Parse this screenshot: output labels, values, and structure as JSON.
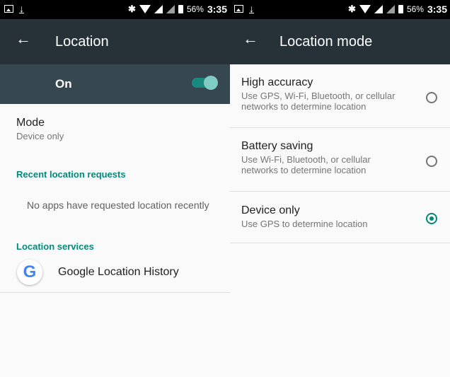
{
  "left": {
    "status": {
      "battery": "56%",
      "time": "3:35"
    },
    "title": "Location",
    "master_switch": {
      "label": "On",
      "state": "on"
    },
    "mode": {
      "title": "Mode",
      "value": "Device only"
    },
    "recent_header": "Recent location requests",
    "recent_empty": "No apps have requested location recently",
    "services_header": "Location services",
    "services": [
      {
        "icon": "google-g-icon",
        "letter": "G",
        "label": "Google Location History"
      }
    ]
  },
  "right": {
    "status": {
      "battery": "56%",
      "time": "3:35"
    },
    "title": "Location mode",
    "options": [
      {
        "title": "High accuracy",
        "desc_line1": "Use GPS, Wi-Fi, Bluetooth, or cellular",
        "desc_line2": "networks to determine location",
        "selected": false
      },
      {
        "title": "Battery saving",
        "desc_line1": "Use Wi-Fi, Bluetooth, or cellular",
        "desc_line2": "networks to determine location",
        "selected": false
      },
      {
        "title": "Device only",
        "desc_line1": "Use GPS to determine location",
        "desc_line2": "",
        "selected": true
      }
    ]
  },
  "colors": {
    "accent": "#00897b",
    "appbar": "#263238",
    "switchbar": "#37474f",
    "status_bar": "#000000"
  }
}
